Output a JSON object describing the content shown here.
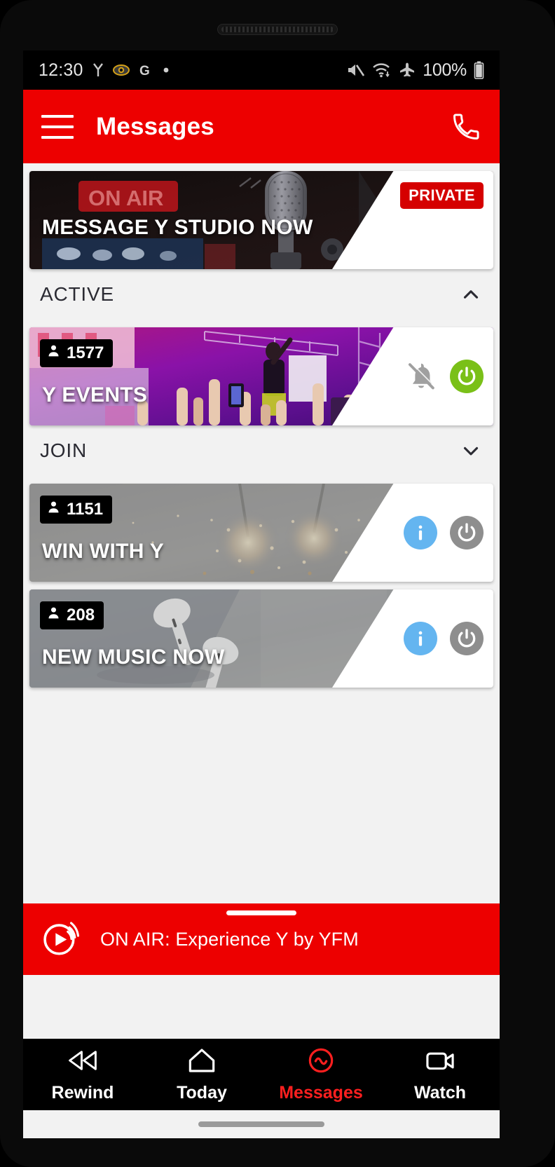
{
  "status_bar": {
    "time": "12:30",
    "battery_percent": "100%",
    "left_icons": [
      "y-logo-icon",
      "eye-icon",
      "google-g-icon",
      "dot-icon"
    ],
    "right_icons": [
      "mute-icon",
      "wifi-icon",
      "airplane-mode-icon",
      "battery-icon"
    ]
  },
  "app_bar": {
    "title": "Messages",
    "menu_icon": "hamburger-menu-icon",
    "call_icon": "phone-icon",
    "background_color": "#ed0000"
  },
  "promo_card": {
    "title": "MESSAGE Y STUDIO NOW",
    "badge": "PRIVATE",
    "badge_color": "#d50000",
    "image": "radio-studio-microphone-on-air"
  },
  "sections": [
    {
      "label": "ACTIVE",
      "chevron": "chevron-up-icon",
      "expanded": true,
      "rooms": [
        {
          "name": "Y EVENTS",
          "members": "1577",
          "image": "concert-crowd-purple-stage",
          "muted": true,
          "mute_icon": "bell-off-icon",
          "power_icon": "power-icon",
          "power_color": "#7ac018",
          "joined": true
        }
      ]
    },
    {
      "label": "JOIN",
      "chevron": "chevron-down-icon",
      "expanded": true,
      "rooms": [
        {
          "name": "WIN WITH Y",
          "members": "1151",
          "image": "sparklers-celebration",
          "info_icon": "info-icon",
          "info_color": "#64b5f0",
          "power_icon": "power-icon",
          "power_color": "#8e8e8e",
          "joined": false
        },
        {
          "name": "NEW MUSIC NOW",
          "members": "208",
          "image": "wireless-earbuds-on-desk",
          "info_icon": "info-icon",
          "info_color": "#64b5f0",
          "power_icon": "power-icon",
          "power_color": "#8e8e8e",
          "joined": false
        }
      ]
    }
  ],
  "player": {
    "text": "ON AIR: Experience Y by YFM",
    "play_icon": "play-broadcast-icon",
    "background_color": "#ed0000"
  },
  "bottom_nav": {
    "active_color": "#ff1f1f",
    "items": [
      {
        "label": "Rewind",
        "icon": "rewind-icon",
        "active": false
      },
      {
        "label": "Today",
        "icon": "home-icon",
        "active": false
      },
      {
        "label": "Messages",
        "icon": "messages-icon",
        "active": true
      },
      {
        "label": "Watch",
        "icon": "video-camera-icon",
        "active": false
      }
    ]
  }
}
